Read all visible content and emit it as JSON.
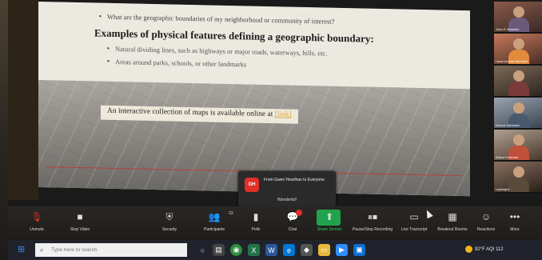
{
  "slide": {
    "bullet_1": "What are the geographic boundaries of my neighborhood or community of interest?",
    "heading": "Examples of physical features defining a geographic boundary:",
    "bullet_2": "Natural dividing lines, such as highways or major roads, waterways, hills, etc.",
    "bullet_3": "Areas around parks, schools, or other landmarks",
    "callout_text": "An interactive collection of maps is available online at",
    "callout_link": "[link]"
  },
  "notification": {
    "avatar": "GH",
    "from": "From Gwen Hearlhan to Everyone",
    "message": "Wonderful!"
  },
  "zoom_controls": [
    {
      "name": "unmute",
      "label": "Unmute",
      "icon": "microphone-muted-icon"
    },
    {
      "name": "stop-video",
      "label": "Stop Video",
      "icon": "camera-icon"
    },
    {
      "name": "security",
      "label": "Security",
      "icon": "shield-icon"
    },
    {
      "name": "participants",
      "label": "Participants",
      "icon": "people-icon"
    },
    {
      "name": "polls",
      "label": "Polls",
      "icon": "chart-icon"
    },
    {
      "name": "chat",
      "label": "Chat",
      "icon": "chat-icon"
    },
    {
      "name": "share-screen",
      "label": "Share Screen",
      "icon": "share-icon"
    },
    {
      "name": "pause-stop-recording",
      "label": "Pause/Stop Recording",
      "icon": "pause-stop-icon"
    },
    {
      "name": "live-transcript",
      "label": "Live Transcript",
      "icon": "cc-icon"
    },
    {
      "name": "breakout-rooms",
      "label": "Breakout Rooms",
      "icon": "grid-icon"
    },
    {
      "name": "reactions",
      "label": "Reactions",
      "icon": "smile-icon"
    },
    {
      "name": "more",
      "label": "More",
      "icon": "more-icon"
    }
  ],
  "participants_badge": "23",
  "gallery": [
    {
      "name": "John E Hamilton"
    },
    {
      "name": "Lana Lindore Sanchez"
    },
    {
      "name": ""
    },
    {
      "name": "Dennis Sylvester"
    },
    {
      "name": "Debra Freeman"
    },
    {
      "name": "Lapbright"
    }
  ],
  "taskbar": {
    "search_placeholder": "Type here to search",
    "weather": "92°F AQI 112"
  },
  "colors": {
    "zoom_green": "#21a34d",
    "chat_red": "#e0302a",
    "windows_blue": "#3a8ee6"
  }
}
